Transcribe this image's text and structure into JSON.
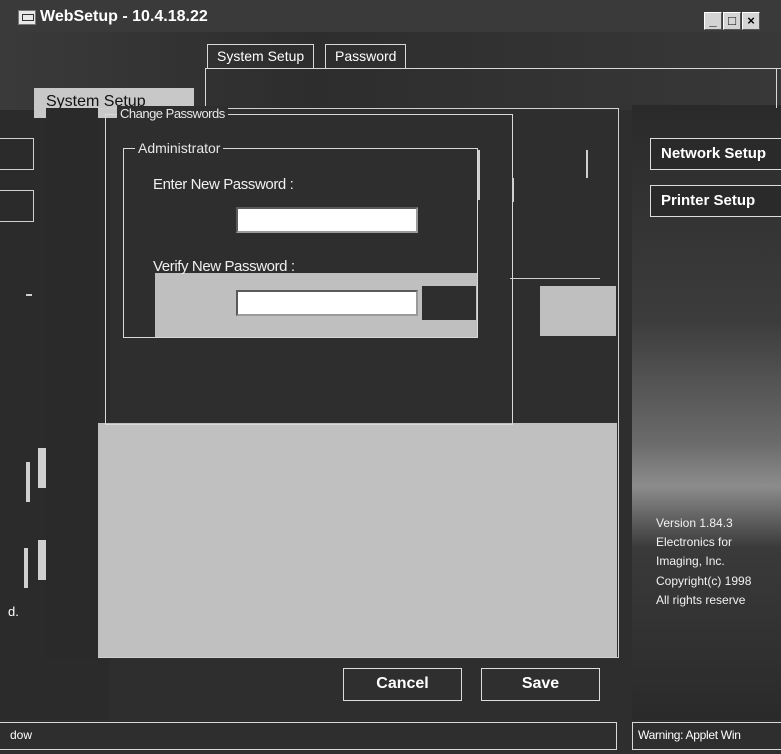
{
  "window": {
    "title": "WebSetup - 10.4.18.22",
    "buttons": {
      "minimize": "_",
      "maximize": "□",
      "close": "×"
    }
  },
  "tabs": [
    {
      "label": "System Setup",
      "active": false
    },
    {
      "label": "Password",
      "active": true
    }
  ],
  "left_panel": {
    "section_label": "System Setup",
    "fragment_text": "d."
  },
  "dialog": {
    "group_title": "Change Passwords",
    "admin_title": "Administrator",
    "new_password_label": "Enter New Password :",
    "new_password_value": "",
    "verify_password_label": "Verify New Password :",
    "verify_password_value": "",
    "cancel_label": "Cancel",
    "save_label": "Save"
  },
  "side_nav": {
    "network_label": "Network Setup",
    "printer_label": "Printer Setup"
  },
  "version_info": [
    "Version 1.84.3",
    "Electronics for",
    "Imaging, Inc.",
    "Copyright(c) 1998",
    "All rights reserve"
  ],
  "status": {
    "left": "dow",
    "right": "Warning: Applet Win"
  },
  "colors": {
    "background": "#2e2e2e",
    "panel_gray": "#c0c0c0",
    "text": "#ffffff"
  },
  "icons": [
    "app-icon",
    "minimize-icon",
    "maximize-icon",
    "close-icon"
  ]
}
